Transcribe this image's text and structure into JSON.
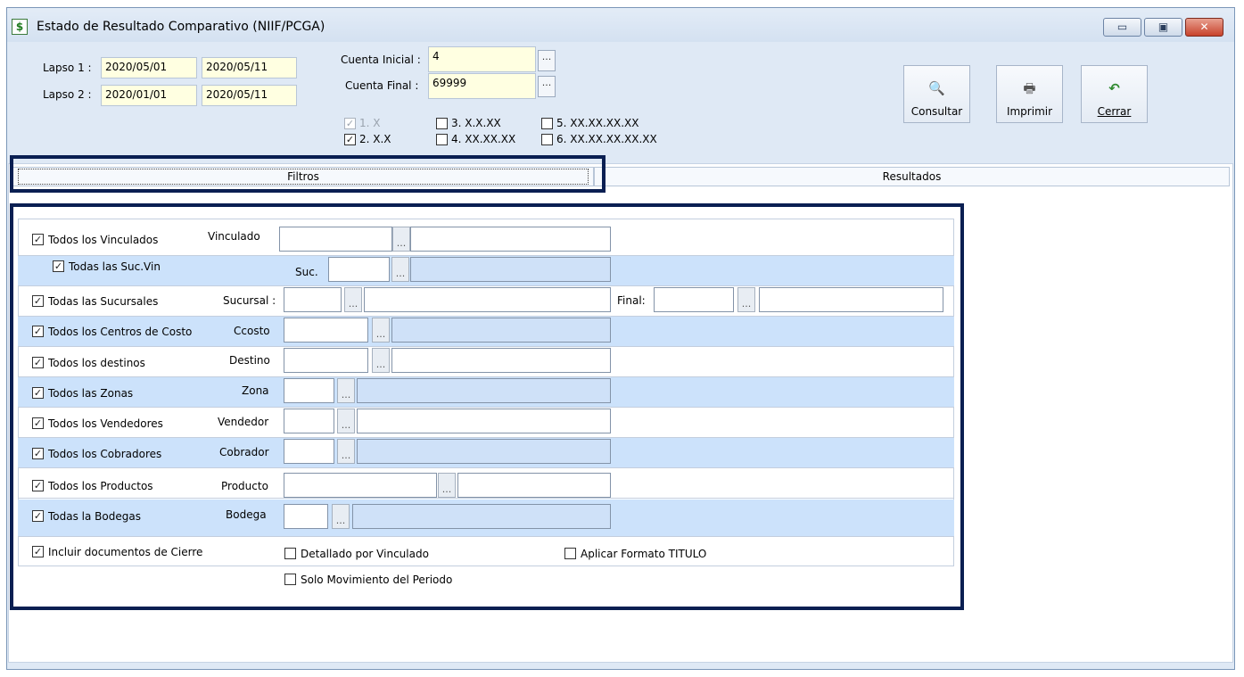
{
  "window": {
    "title": "Estado de Resultado Comparativo (NIIF/PCGA)"
  },
  "header": {
    "lapso1_label": "Lapso 1 :",
    "lapso1_from": "2020/05/01",
    "lapso1_to": "2020/05/11",
    "lapso2_label": "Lapso 2 :",
    "lapso2_from": "2020/01/01",
    "lapso2_to": "2020/05/11",
    "cuenta_inicial_label": "Cuenta Inicial :",
    "cuenta_inicial": "4",
    "cuenta_final_label": "Cuenta Final :",
    "cuenta_final": "69999",
    "ellipsis": "...",
    "levels": [
      {
        "label": "1. X",
        "checked": true,
        "disabled": true
      },
      {
        "label": "2. X.X",
        "checked": true,
        "disabled": false
      },
      {
        "label": "3. X.X.XX",
        "checked": false,
        "disabled": false
      },
      {
        "label": "4. XX.XX.XX",
        "checked": false,
        "disabled": false
      },
      {
        "label": "5. XX.XX.XX.XX",
        "checked": false,
        "disabled": false
      },
      {
        "label": "6. XX.XX.XX.XX.XX",
        "checked": false,
        "disabled": false
      }
    ]
  },
  "toolbar": {
    "consultar": "Consultar",
    "imprimir": "Imprimir",
    "cerrar": "Cerrar"
  },
  "tabs": {
    "filtros": "Filtros",
    "resultados": "Resultados"
  },
  "filters": [
    {
      "check": "Todos los Vinculados",
      "field": "Vinculado"
    },
    {
      "check": "Todas las Suc.Vin",
      "field": "Suc."
    },
    {
      "check": "Todas las Sucursales",
      "field": "Sucursal :",
      "final": "Final:"
    },
    {
      "check": "Todos los Centros de Costo",
      "field": "Ccosto"
    },
    {
      "check": "Todos los destinos",
      "field": "Destino"
    },
    {
      "check": "Todos las Zonas",
      "field": "Zona"
    },
    {
      "check": "Todos los Vendedores",
      "field": "Vendedor"
    },
    {
      "check": "Todos los Cobradores",
      "field": "Cobrador"
    },
    {
      "check": "Todos los Productos",
      "field": "Producto"
    },
    {
      "check": "Todas la Bodegas",
      "field": "Bodega"
    }
  ],
  "options": {
    "incluir_cierre": "Incluir documentos de Cierre",
    "detallado_vinculado": "Detallado por Vinculado",
    "formato_titulo": "Aplicar Formato TITULO",
    "solo_movimiento": "Solo Movimiento del Periodo"
  },
  "colors": {
    "highlight": "#0a1f52",
    "field_yellow": "#ffffe1",
    "row_blue": "#cce2fb"
  }
}
